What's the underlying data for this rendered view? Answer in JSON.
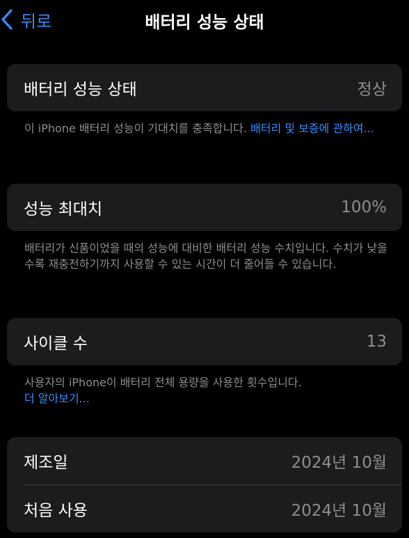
{
  "nav": {
    "back_label": "뒤로",
    "title": "배터리 성능 상태"
  },
  "battery_health": {
    "label": "배터리 성능 상태",
    "value": "정상",
    "description": "이 iPhone 배터리 성능이 기대치를 충족합니다. ",
    "link": "배터리 및 보증에 관하여..."
  },
  "max_capacity": {
    "label": "성능 최대치",
    "value": "100%",
    "description": "배터리가 신품이었을 때의 성능에 대비한 배터리 성능 수치입니다. 수치가 낮을수록 재충전하기까지 사용할 수 있는 시간이 더 줄어들 수 있습니다."
  },
  "cycle_count": {
    "label": "사이클 수",
    "value": "13",
    "description": "사용자의 iPhone이 배터리 전체 용량을 사용한 횟수입니다.",
    "link": "더 알아보기..."
  },
  "dates": {
    "manufacture_label": "제조일",
    "manufacture_value": "2024년 10월",
    "first_use_label": "처음 사용",
    "first_use_value": "2024년 10월"
  },
  "colors": {
    "background": "#000000",
    "card": "#1c1c1e",
    "accent": "#3a8ef7",
    "secondary_text": "#8e8e93"
  },
  "icons": {
    "back": "chevron-left-icon"
  }
}
